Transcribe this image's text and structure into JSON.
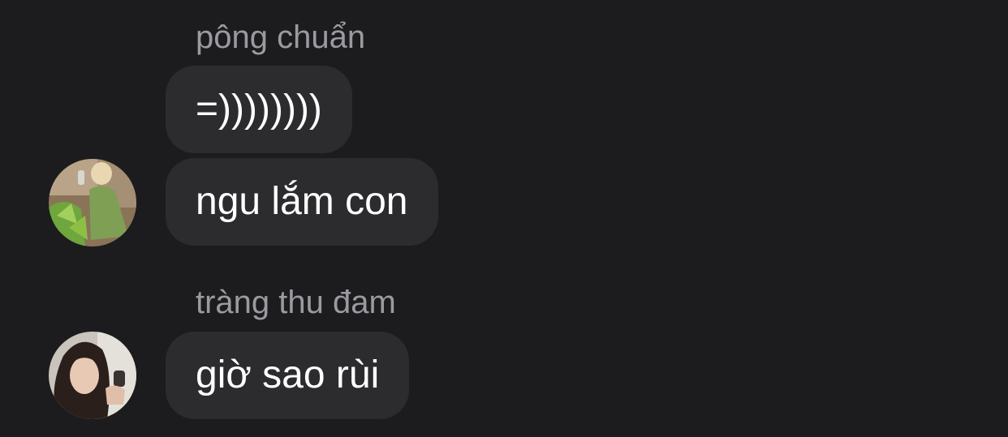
{
  "messages": [
    {
      "sender": "pông chuẩn",
      "bubbles": [
        "=))))))))",
        "ngu lắm con"
      ],
      "avatar": "avatar-photo-woman-green-dress"
    },
    {
      "sender": "tràng thu đam",
      "bubbles": [
        "giờ sao rùi"
      ],
      "avatar": "avatar-photo-woman-selfie"
    }
  ],
  "colors": {
    "background": "#1c1c1e",
    "bubble": "#2c2c2e",
    "sender_name": "#9a9aa0",
    "message_text": "#ffffff"
  }
}
